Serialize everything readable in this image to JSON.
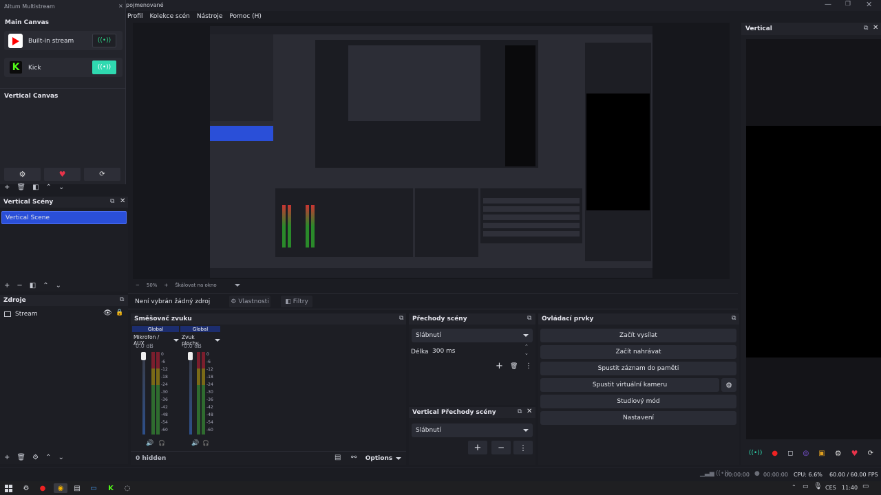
{
  "window": {
    "title": "pojmenované"
  },
  "menu": [
    "Profil",
    "Kolekce scén",
    "Nástroje",
    "Pomoc (H)"
  ],
  "multistream": {
    "title": "Aitum Multistream",
    "main_canvas": "Main Canvas",
    "outputs": [
      {
        "name": "Built-in stream",
        "icon": "youtube-icon"
      },
      {
        "name": "Kick",
        "icon": "kick-icon"
      }
    ],
    "vertical_canvas": "Vertical Canvas"
  },
  "vertical_scenes": {
    "title": "Vertical Scény",
    "items": [
      "Vertical Scene"
    ]
  },
  "sources": {
    "title": "Zdroje",
    "items": [
      "Stream"
    ]
  },
  "preview_bar": {
    "zoom": "50%",
    "scale": "Škálovat na okno"
  },
  "properties_bar": {
    "no_source": "Není vybrán žádný zdroj",
    "properties": "Vlastnosti",
    "filters": "Filtry"
  },
  "mixer": {
    "title": "Směšovač zvuku",
    "channels": [
      {
        "tag": "Global",
        "name": "Mikrofon / AUX",
        "db": "0.0 dB"
      },
      {
        "tag": "Global",
        "name": "Zvuk plochy",
        "db": "0.0 dB"
      }
    ],
    "ticks": [
      "0",
      "-6",
      "-12",
      "-18",
      "-24",
      "-30",
      "-36",
      "-42",
      "-48",
      "-54",
      "-60"
    ],
    "hidden": "0 hidden",
    "options": "Options"
  },
  "transitions": {
    "title": "Přechody scény",
    "selected": "Slábnutí",
    "duration_label": "Délka",
    "duration": "300 ms"
  },
  "vertical_transitions": {
    "title": "Vertical Přechody scény",
    "selected": "Slábnutí"
  },
  "controls": {
    "title": "Ovládací prvky",
    "buttons": [
      "Začít vysílat",
      "Začít nahrávat",
      "Spustit záznam do paměti",
      "Spustit virtuální kameru",
      "Studiový mód",
      "Nastavení"
    ]
  },
  "vertical_dock": {
    "title": "Vertical"
  },
  "status": {
    "stream_time": "00:00:00",
    "rec_time": "00:00:00",
    "cpu": "CPU: 6.6%",
    "fps": "60.00 / 60.00 FPS"
  },
  "taskbar": {
    "lang": "CES",
    "time": "11:40"
  },
  "colors": {
    "accent": "#2a4fd8",
    "kick": "#53fc18",
    "youtube": "#ff0000",
    "bg": "#1b1c22",
    "panel": "#23242b"
  }
}
